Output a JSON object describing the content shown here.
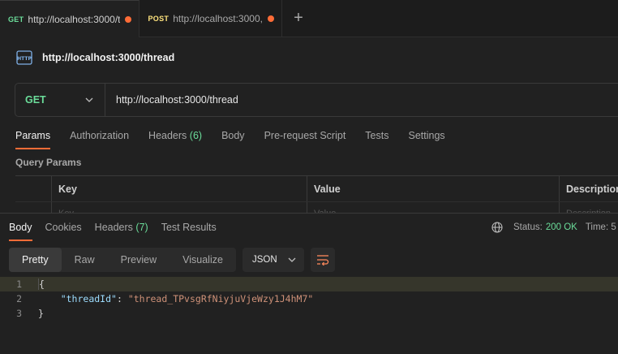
{
  "tabs": [
    {
      "method": "GET",
      "url": "http://localhost:3000/t"
    },
    {
      "method": "POST",
      "url": "http://localhost:3000,"
    }
  ],
  "tab_add_label": "+",
  "request": {
    "title": "http://localhost:3000/thread",
    "method": "GET",
    "url": "http://localhost:3000/thread"
  },
  "request_tabs": [
    {
      "label": "Params",
      "count": ""
    },
    {
      "label": "Authorization",
      "count": ""
    },
    {
      "label": "Headers",
      "count": "(6)"
    },
    {
      "label": "Body",
      "count": ""
    },
    {
      "label": "Pre-request Script",
      "count": ""
    },
    {
      "label": "Tests",
      "count": ""
    },
    {
      "label": "Settings",
      "count": ""
    }
  ],
  "query_params": {
    "label": "Query Params",
    "headers": {
      "key": "Key",
      "value": "Value",
      "description": "Description"
    },
    "placeholders": {
      "key": "Key",
      "value": "Value",
      "description": "Description"
    }
  },
  "response": {
    "tabs": [
      {
        "label": "Body",
        "count": ""
      },
      {
        "label": "Cookies",
        "count": ""
      },
      {
        "label": "Headers",
        "count": "(7)"
      },
      {
        "label": "Test Results",
        "count": ""
      }
    ],
    "status_label": "Status:",
    "status_value": "200 OK",
    "time_label": "Time: 5",
    "views": [
      "Pretty",
      "Raw",
      "Preview",
      "Visualize"
    ],
    "format": "JSON",
    "code_lines": [
      {
        "num": "1",
        "open": "{"
      },
      {
        "num": "2",
        "key": "\"threadId\"",
        "colon": ": ",
        "value": "\"thread_TPvsgRfNiyjuVjeWzy1J4hM7\""
      },
      {
        "num": "3",
        "close": "}"
      }
    ]
  },
  "colors": {
    "accent": "#ff6c37",
    "get": "#6bdd9a",
    "post": "#ffe47e",
    "background": "#212121"
  }
}
